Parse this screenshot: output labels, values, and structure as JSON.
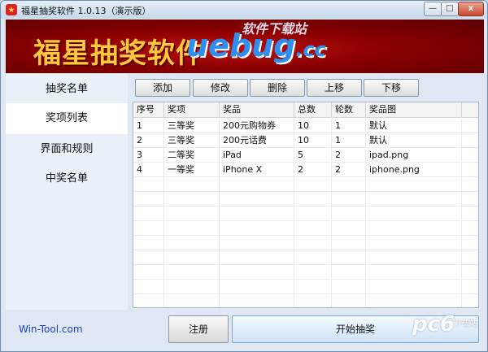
{
  "window": {
    "title": "福星抽奖软件 1.0.13（演示版）",
    "controls": {
      "minimize": "—",
      "maximize": "□",
      "close": "x"
    }
  },
  "banner": {
    "title": "福星抽奖软件",
    "watermark_site": "软件下载站",
    "watermark_brand": "uebug",
    "watermark_tld": ".cc"
  },
  "sidebar": {
    "items": [
      {
        "label": "抽奖名单",
        "active": false
      },
      {
        "label": "奖项列表",
        "active": true
      },
      {
        "label": "界面和规则",
        "active": false
      },
      {
        "label": "中奖名单",
        "active": false
      }
    ]
  },
  "toolbar": {
    "add": "添加",
    "edit": "修改",
    "delete": "删除",
    "move_up": "上移",
    "move_down": "下移"
  },
  "table": {
    "columns": [
      "序号",
      "奖项",
      "奖品",
      "总数",
      "轮数",
      "奖品图"
    ],
    "rows": [
      [
        "1",
        "三等奖",
        "200元购物券",
        "10",
        "1",
        "默认"
      ],
      [
        "2",
        "三等奖",
        "200元话费",
        "10",
        "1",
        "默认"
      ],
      [
        "3",
        "二等奖",
        "iPad",
        "5",
        "2",
        "ipad.png"
      ],
      [
        "4",
        "一等奖",
        "iPhone X",
        "2",
        "2",
        "iphone.png"
      ]
    ]
  },
  "footer": {
    "link": "Win-Tool.com",
    "register": "注册",
    "start": "开始抽奖",
    "watermark": "pc6",
    "watermark_sub": "下载站"
  },
  "colors": {
    "banner_red": "#8a0000",
    "banner_title": "#ffc83d",
    "link_blue": "#1a3fc0"
  }
}
